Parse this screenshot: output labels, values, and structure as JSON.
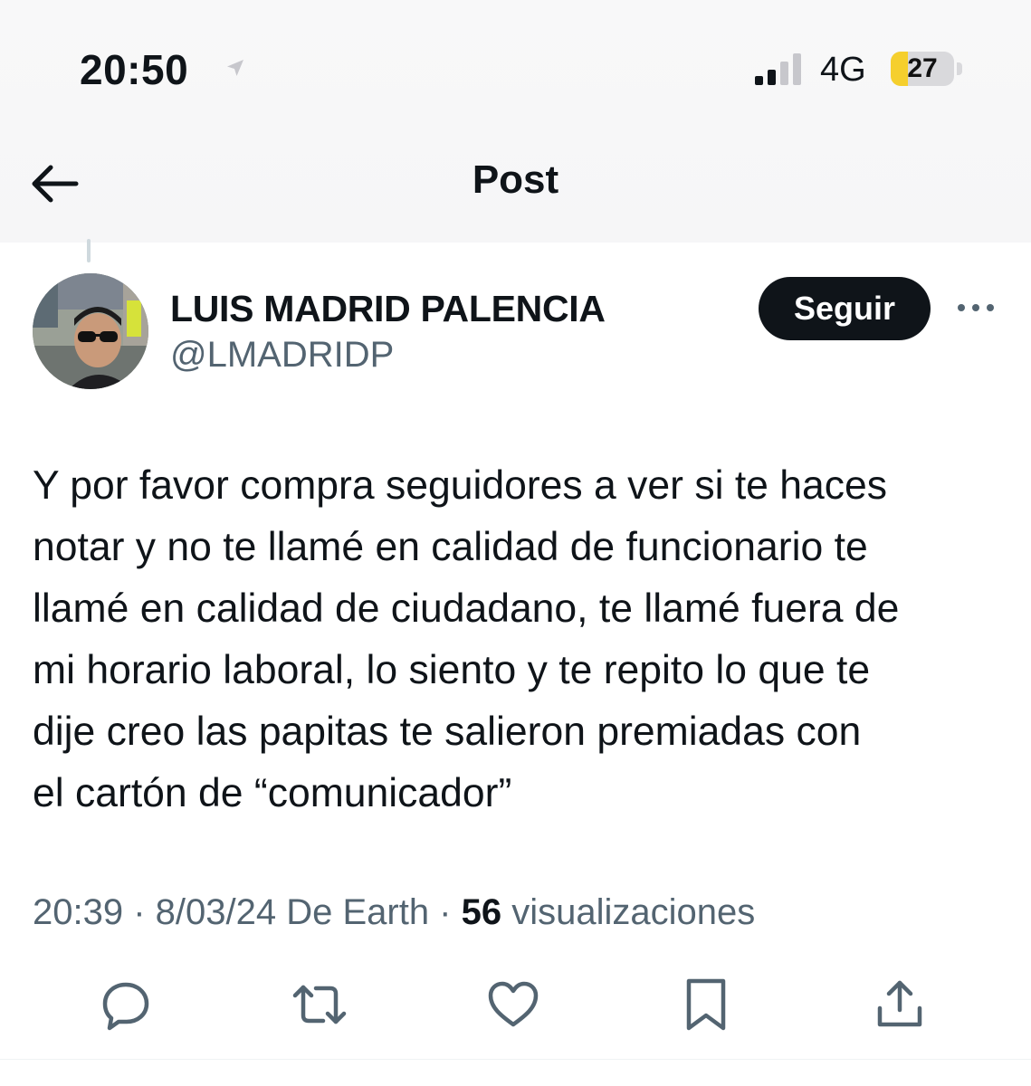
{
  "status_bar": {
    "time": "20:50",
    "network": "4G",
    "battery_level": 27,
    "battery_label": "27",
    "battery_fill_color": "#f5cf2d"
  },
  "nav": {
    "back_icon": "arrow-left-icon",
    "title": "Post"
  },
  "post": {
    "author": {
      "name": "LUIS MADRID PALENCIA",
      "handle": "@LMADRIDP"
    },
    "follow_label": "Seguir",
    "more_icon": "more-horizontal-icon",
    "text_lines": [
      "Y por favor compra seguidores a ver si te haces",
      "notar y no te llamé en calidad de funcionario te",
      "llamé en calidad de ciudadano, te llamé fuera de",
      "mi horario laboral, lo siento y te repito lo que te",
      "dije creo las papitas te salieron premiadas con",
      "el cartón de “comunicador”"
    ],
    "meta": {
      "prefix": "20:39 · 8/03/24 De Earth · ",
      "views_count": "56",
      "views_label": " visualizaciones"
    },
    "actions": [
      {
        "name": "reply",
        "icon": "reply-icon"
      },
      {
        "name": "repost",
        "icon": "repost-icon"
      },
      {
        "name": "like",
        "icon": "heart-icon"
      },
      {
        "name": "bookmark",
        "icon": "bookmark-icon"
      },
      {
        "name": "share",
        "icon": "share-icon"
      }
    ]
  },
  "colors": {
    "text_primary": "#0f1419",
    "text_secondary": "#536471",
    "follow_bg": "#0f1419"
  }
}
